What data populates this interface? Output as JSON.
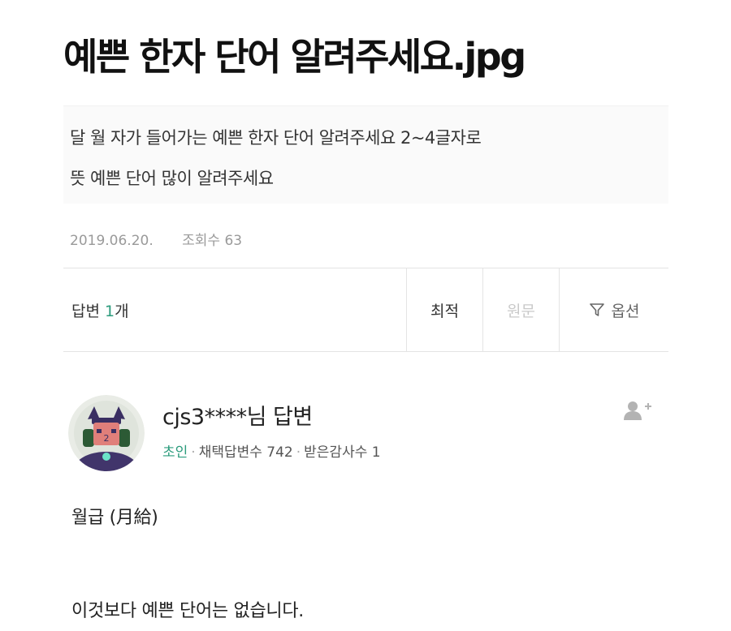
{
  "post": {
    "title": "예쁜 한자 단어 알려주세요.jpg",
    "question_lines": [
      "달 월 자가 들어가는 예쁜 한자 단어 알려주세요 2~4글자로",
      "뜻 예쁜 단어 많이 알려주세요"
    ],
    "date": "2019.06.20.",
    "views": "조회수 63"
  },
  "answers_bar": {
    "label": "답변",
    "count": "1",
    "unit": "개",
    "sort_best": "최적",
    "sort_original": "원문",
    "options": "옵션"
  },
  "answer": {
    "author": "cjs3****님 답변",
    "grade": "초인",
    "adopted": "채택답변수 742",
    "thanks": "받은감사수 1",
    "line1": "월급 (月給)",
    "line2": "이것보다 예쁜 단어는 없습니다."
  },
  "icons": {
    "filter": "filter-icon",
    "follow": "add-friend-icon",
    "avatar": "character-avatar"
  },
  "colors": {
    "accent": "#2b9b7c",
    "muted": "#9a9a9a"
  }
}
